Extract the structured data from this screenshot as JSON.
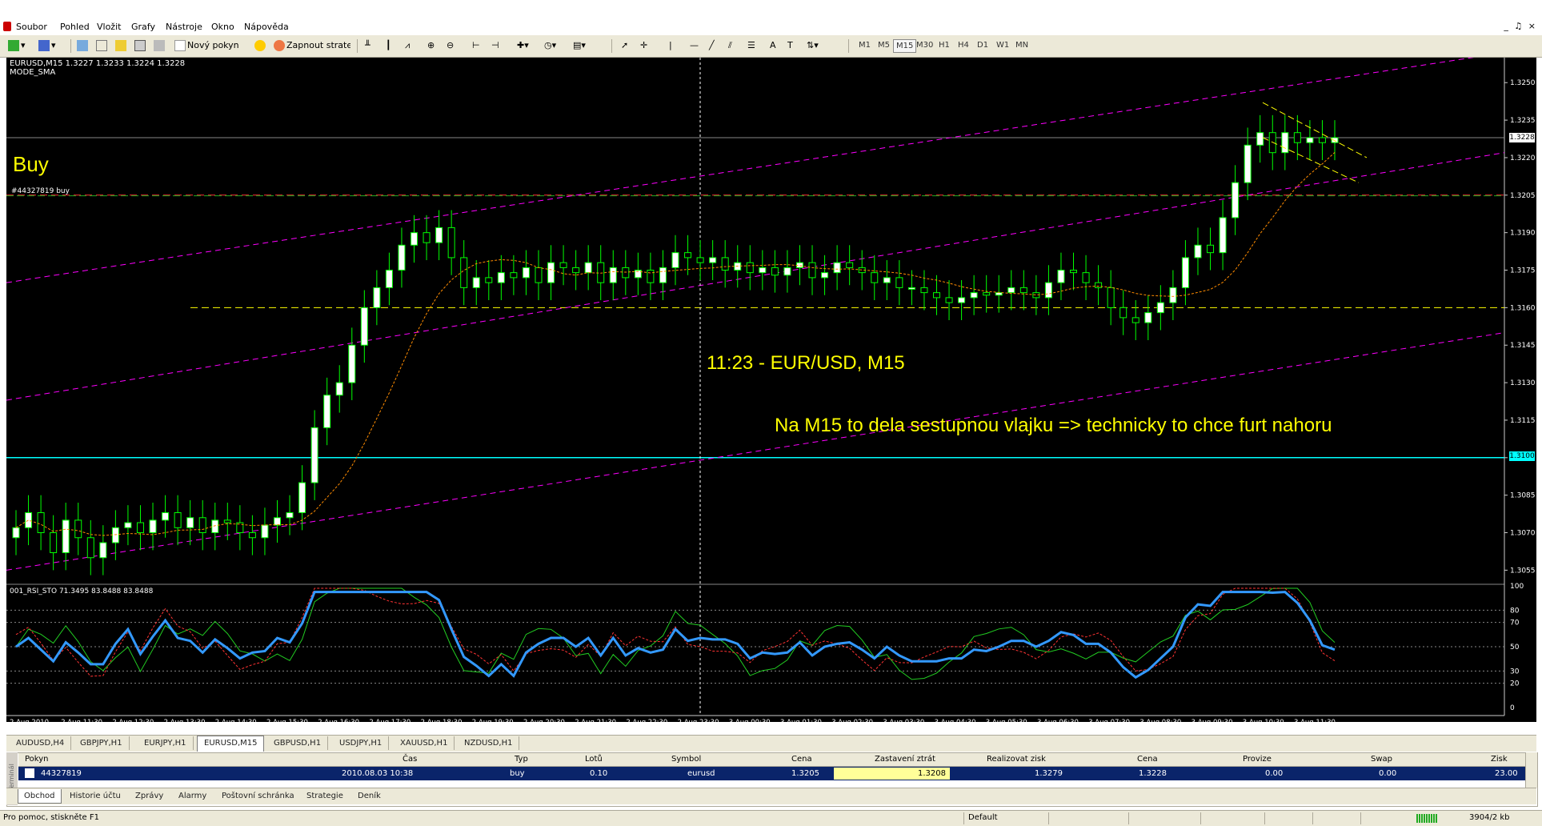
{
  "menu": [
    "Soubor",
    "Pohled",
    "Vložit",
    "Grafy",
    "Nástroje",
    "Okno",
    "Nápověda"
  ],
  "window_controls": "_ ♫ ×",
  "toolbar": {
    "new_order_label": "Nový pokyn",
    "expert_label": "Zapnout strategie",
    "timeframes": [
      "M1",
      "M5",
      "M15",
      "M30",
      "H1",
      "H4",
      "D1",
      "W1",
      "MN"
    ],
    "active_timeframe": "M15"
  },
  "chart": {
    "info_line": "EURUSD,M15  1.3227 1.3233 1.3224 1.3228",
    "indicator_name": "MODE_SMA",
    "buy_text": "Buy",
    "order_line_label": "#44327819 buy",
    "annotation_title": "11:23 - EUR/USD,  M15",
    "annotation_comment": "Na M15 to dela sestupnou vlajku => technicky to chce furt  nahoru",
    "current_price_tag": "1.3228",
    "line_price_tag": "1.3100",
    "price_ticks": [
      "1.3250",
      "1.3235",
      "1.3220",
      "1.3205",
      "1.3190",
      "1.3175",
      "1.3160",
      "1.3145",
      "1.3130",
      "1.3115",
      "1.3100",
      "1.3085",
      "1.3070",
      "1.3055"
    ],
    "sub_info": "001_RSI_STO 71.3495 83.8488 83.8488",
    "sub_ticks": [
      "100",
      "80",
      "70",
      "50",
      "30",
      "20",
      "0"
    ],
    "time_labels": [
      "2 Aug 2010",
      "2 Aug 11:30",
      "2 Aug 12:30",
      "2 Aug 13:30",
      "2 Aug 14:30",
      "2 Aug 15:30",
      "2 Aug 16:30",
      "2 Aug 17:30",
      "2 Aug 18:30",
      "2 Aug 19:30",
      "2 Aug 20:30",
      "2 Aug 21:30",
      "2 Aug 22:30",
      "2 Aug 23:30",
      "3 Aug 00:30",
      "3 Aug 01:30",
      "3 Aug 02:30",
      "3 Aug 03:30",
      "3 Aug 04:30",
      "3 Aug 05:30",
      "3 Aug 06:30",
      "3 Aug 07:30",
      "3 Aug 08:30",
      "3 Aug 09:30",
      "3 Aug 10:30",
      "3 Aug 11:30"
    ],
    "colors": {
      "bg": "#000000",
      "up": "#00ff00",
      "candle_body": "#ffffff",
      "sma": "#ff8c00",
      "channel": "#ff00ff",
      "text": "#ffff00",
      "hline": "#00ffff"
    }
  },
  "chart_data": {
    "type": "candlestick",
    "symbol": "EURUSD",
    "timeframe": "M15",
    "ylim": [
      1.305,
      1.326
    ],
    "closes": [
      1.3072,
      1.3078,
      1.307,
      1.3062,
      1.3075,
      1.3068,
      1.306,
      1.3066,
      1.3072,
      1.3074,
      1.307,
      1.3075,
      1.3078,
      1.3072,
      1.3076,
      1.307,
      1.3075,
      1.3074,
      1.307,
      1.3068,
      1.3073,
      1.3076,
      1.3078,
      1.309,
      1.3112,
      1.3125,
      1.313,
      1.3145,
      1.316,
      1.3168,
      1.3175,
      1.3185,
      1.319,
      1.3186,
      1.3192,
      1.318,
      1.3168,
      1.3172,
      1.317,
      1.3174,
      1.3172,
      1.3176,
      1.317,
      1.3178,
      1.3176,
      1.3174,
      1.3178,
      1.317,
      1.3176,
      1.3172,
      1.3175,
      1.317,
      1.3176,
      1.3182,
      1.318,
      1.3178,
      1.318,
      1.3175,
      1.3178,
      1.3174,
      1.3176,
      1.3173,
      1.3176,
      1.3178,
      1.3172,
      1.3174,
      1.3178,
      1.3176,
      1.3174,
      1.317,
      1.3172,
      1.3168,
      1.3168,
      1.3166,
      1.3164,
      1.3162,
      1.3164,
      1.3166,
      1.3165,
      1.3166,
      1.3168,
      1.3166,
      1.3164,
      1.317,
      1.3175,
      1.3174,
      1.317,
      1.3168,
      1.316,
      1.3156,
      1.3154,
      1.3158,
      1.3162,
      1.3168,
      1.318,
      1.3185,
      1.3182,
      1.3196,
      1.321,
      1.3225,
      1.323,
      1.3222,
      1.323,
      1.3226,
      1.3228,
      1.3226,
      1.3228
    ],
    "horizontal_levels": [
      1.3205,
      1.31,
      1.316
    ],
    "oscillator": {
      "name": "001_RSI_STO",
      "values": [
        71.3495,
        83.8488,
        83.8488
      ],
      "levels": [
        80,
        70,
        50,
        30,
        20
      ]
    }
  },
  "tabs": [
    {
      "label": "AUDUSD,H4"
    },
    {
      "label": "GBPJPY,H1"
    },
    {
      "label": "EURJPY,H1"
    },
    {
      "label": "EURUSD,M15",
      "active": true
    },
    {
      "label": "GBPUSD,H1"
    },
    {
      "label": "USDJPY,H1"
    },
    {
      "label": "XAUUSD,H1"
    },
    {
      "label": "NZDUSD,H1"
    }
  ],
  "terminal": {
    "side_label": "Terminál",
    "columns": [
      "Pokyn",
      "Čas",
      "Typ",
      "Lotů",
      "Symbol",
      "Cena",
      "Zastavení ztrát",
      "Realizovat zisk",
      "Cena",
      "Provize",
      "Swap",
      "Zisk"
    ],
    "row": {
      "order": "44327819",
      "time": "2010.08.03 10:38",
      "type": "buy",
      "lots": "0.10",
      "symbol": "eurusd",
      "price": "1.3205",
      "sl": "1.3208",
      "tp": "1.3279",
      "cur": "1.3228",
      "comm": "0.00",
      "swap": "0.00",
      "profit": "23.00"
    },
    "bottom_tabs": [
      "Obchod",
      "Historie účtu",
      "Zprávy",
      "Alarmy",
      "Poštovní schránka",
      "Strategie",
      "Deník"
    ]
  },
  "status": {
    "help": "Pro pomoc, stiskněte F1",
    "profile": "Default",
    "traffic": "3904/2 kb"
  }
}
